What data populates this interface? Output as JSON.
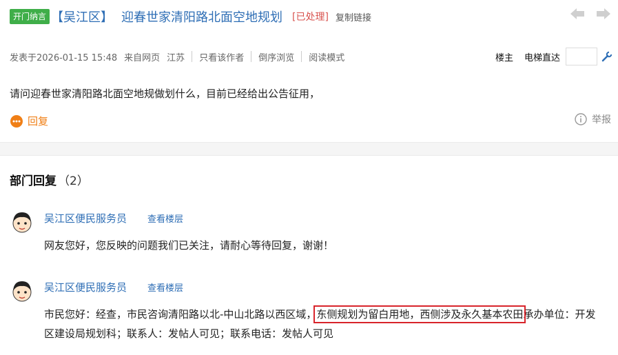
{
  "post": {
    "badge": "开门纳言",
    "region": "【吴江区】",
    "title": "迎春世家清阳路北面空地规划",
    "status": "[已处理]",
    "copy_link": "复制链接"
  },
  "meta": {
    "posted": "发表于2026-01-15 15:48",
    "source": "来自网页",
    "location": "江苏",
    "only_author": "只看该作者",
    "reverse": "倒序浏览",
    "read_mode": "阅读模式"
  },
  "tools": {
    "owner": "楼主",
    "elevator": "电梯直达",
    "jump_placeholder": ""
  },
  "content": "请问迎春世家清阳路北面空地规做划什么，目前已经给出公告征用，",
  "actions": {
    "reply": "回复",
    "report": "举报"
  },
  "department": {
    "title": "部门回复",
    "count": "（2）"
  },
  "replies": [
    {
      "author": "吴江区便民服务员",
      "view_floor": "查看楼层",
      "body": "网友您好，您反映的问题我们已关注，请耐心等待回复，谢谢！"
    },
    {
      "author": "吴江区便民服务员",
      "view_floor": "查看楼层",
      "body_before": "市民您好：经查，市民咨询清阳路以北-中山北路以西区域，",
      "body_highlight": "东侧规划为留白用地，西侧涉及永久基本农田",
      "body_after": "承办单位：开发区建设局规划科；联系人：发帖人可见；联系电话：发帖人可见"
    }
  ],
  "colors": {
    "badge_green": "#3fae49",
    "link_blue": "#2e6eb5",
    "status_red": "#d9534f",
    "reply_orange": "#f07f16",
    "highlight_red": "#d8232a"
  },
  "icons": {
    "prev": "arrow-left-icon",
    "next": "arrow-right-icon",
    "jump": "wrench-icon",
    "reply": "speech-bubble-icon",
    "report": "info-circle-icon",
    "avatar": "cartoon-avatar-icon"
  }
}
